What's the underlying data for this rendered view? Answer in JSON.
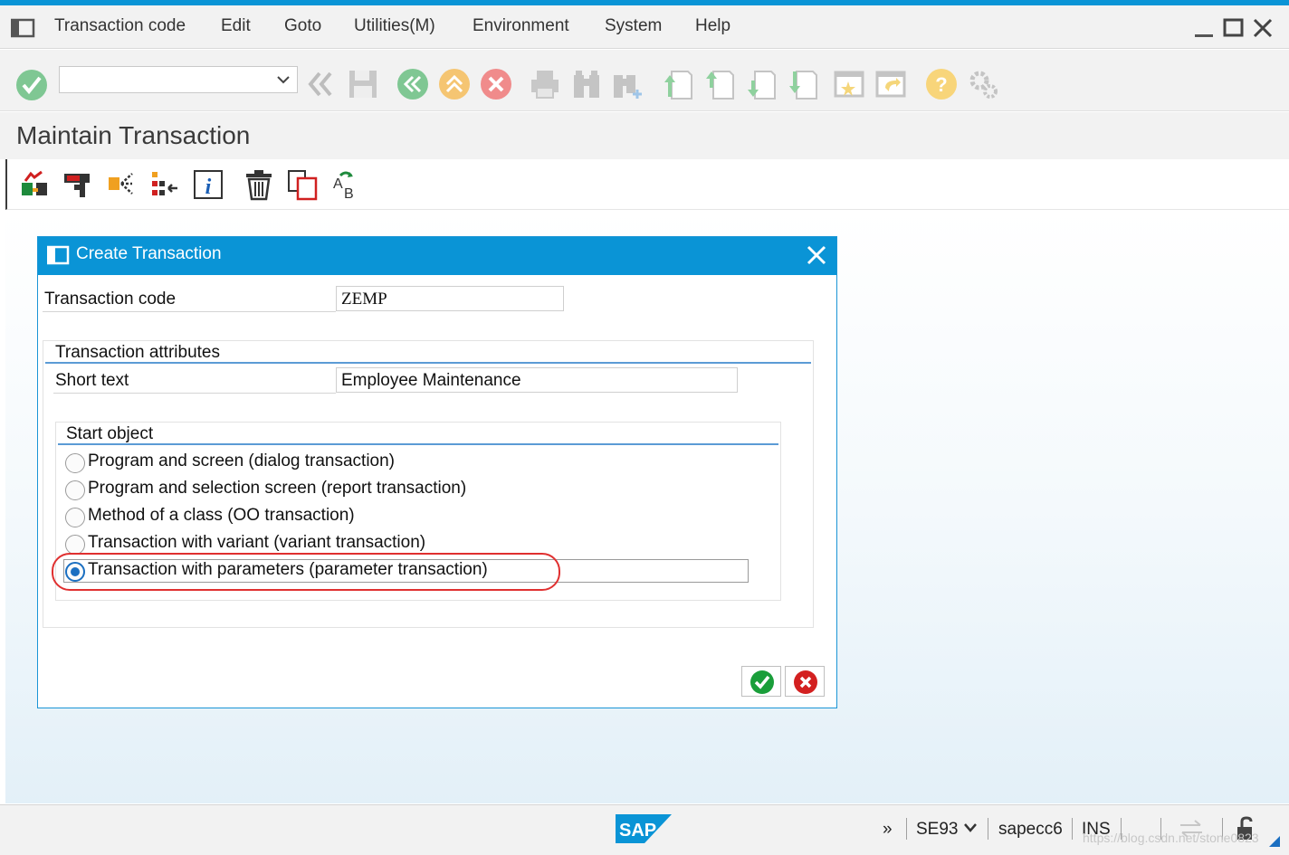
{
  "menubar": {
    "items": [
      "Transaction code",
      "Edit",
      "Goto",
      "Utilities(M)",
      "Environment",
      "System",
      "Help"
    ]
  },
  "toolbar": {
    "command_field_value": "",
    "icons": [
      "enter-icon",
      "back-nav-icon",
      "save-icon",
      "back-icon",
      "exit-icon",
      "cancel-icon",
      "print-icon",
      "find-icon",
      "find-next-icon",
      "first-page-icon",
      "previous-page-icon",
      "next-page-icon",
      "last-page-icon",
      "new-session-icon",
      "shortcut-icon",
      "help-icon",
      "settings-icon"
    ]
  },
  "page": {
    "title": "Maintain Transaction"
  },
  "app_toolbar": {
    "icons": [
      "other-object-icon",
      "display-change-icon",
      "where-used-icon",
      "object-list-icon",
      "info-icon",
      "delete-icon",
      "copy-icon",
      "rename-icon"
    ]
  },
  "dialog": {
    "title": "Create Transaction",
    "transaction_code_label": "Transaction code",
    "transaction_code_value": "ZEMP",
    "attributes_title": "Transaction attributes",
    "short_text_label": "Short text",
    "short_text_value": "Employee Maintenance",
    "start_object_title": "Start object",
    "options": [
      {
        "label": "Program and screen (dialog transaction)",
        "selected": false
      },
      {
        "label": "Program and selection screen (report transaction)",
        "selected": false
      },
      {
        "label": "Method of a class (OO transaction)",
        "selected": false
      },
      {
        "label": "Transaction with variant (variant transaction)",
        "selected": false
      },
      {
        "label": "Transaction with parameters (parameter transaction)",
        "selected": true
      }
    ]
  },
  "statusbar": {
    "logo": "SAP",
    "expand": "»",
    "tcode": "SE93",
    "system": "sapecc6",
    "mode": "INS",
    "watermark": "https://blog.csdn.net/stone0823"
  },
  "colors": {
    "accent": "#0a94d6",
    "highlight": "#e03030",
    "ok_green": "#1a9e3a",
    "cancel_red": "#d32020"
  }
}
